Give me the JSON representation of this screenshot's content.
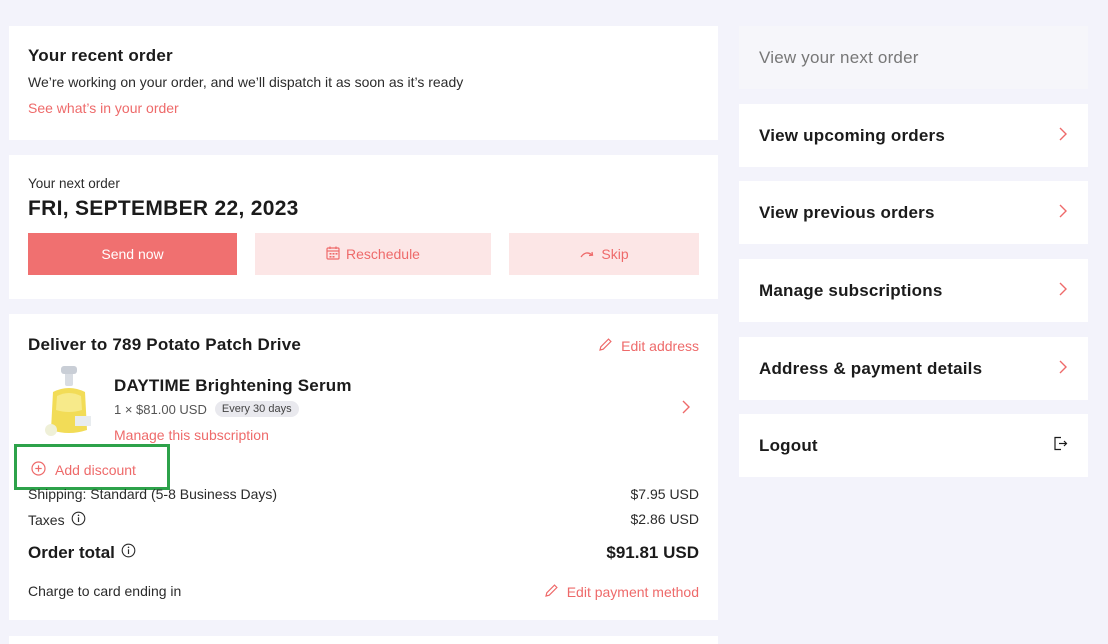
{
  "recent_order": {
    "title": "Your recent order",
    "description": "We’re working on your order, and we’ll dispatch it as soon as it’s ready",
    "link": "See what’s in your order"
  },
  "next_order": {
    "label": "Your next order",
    "date": "FRI, SEPTEMBER 22, 2023",
    "send_now": "Send now",
    "reschedule": "Reschedule",
    "skip": "Skip"
  },
  "delivery": {
    "title": "Deliver to 789 Potato Patch Drive",
    "edit_address": "Edit address",
    "product": {
      "name": "DAYTIME Brightening Serum",
      "qty_price": "1 × $81.00 USD",
      "frequency": "Every 30 days",
      "manage": "Manage this subscription"
    },
    "add_discount": "Add discount",
    "shipping_label": "Shipping: Standard (5-8 Business Days)",
    "shipping_value": "$7.95 USD",
    "taxes_label": "Taxes",
    "taxes_value": "$2.86 USD",
    "total_label": "Order total",
    "total_value": "$91.81 USD",
    "charge_label": "Charge to card ending in",
    "edit_payment": "Edit payment method"
  },
  "sidebar": {
    "items": [
      {
        "label": "View your next order"
      },
      {
        "label": "View upcoming orders"
      },
      {
        "label": "View previous orders"
      },
      {
        "label": "Manage subscriptions"
      },
      {
        "label": "Address & payment details"
      },
      {
        "label": "Logout"
      }
    ]
  },
  "colors": {
    "accent": "#ee6a6a",
    "primary_button": "#f07070",
    "soft_button": "#fce6e6",
    "page_bg": "#f3f3fb",
    "highlight": "#2da24a"
  },
  "icons": [
    "calendar-icon",
    "skip-arrow-icon",
    "pencil-icon",
    "chevron-right-icon",
    "plus-circle-icon",
    "info-icon",
    "logout-icon"
  ]
}
